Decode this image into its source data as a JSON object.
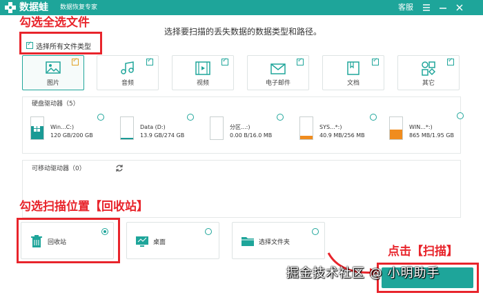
{
  "titlebar": {
    "app_name": "数据蛙",
    "app_subtitle": "数据恢复专家",
    "service_label": "客服",
    "menu_icon": "menu-icon",
    "min_icon": "minimize-icon",
    "close_icon": "close-icon"
  },
  "annotations": {
    "select_all_note": "勾选全选文件",
    "location_note": "勾选扫描位置【回收站】",
    "scan_note": "点击【扫描】"
  },
  "instruction": "选择要扫描的丢失数据的数据类型和路径。",
  "select_all": {
    "label": "选择所有文件类型",
    "checked": true
  },
  "file_types": [
    {
      "label": "图片",
      "icon": "image-icon",
      "checked": true,
      "selected": true
    },
    {
      "label": "音频",
      "icon": "music-icon",
      "checked": true,
      "selected": false
    },
    {
      "label": "视频",
      "icon": "video-icon",
      "checked": true,
      "selected": false
    },
    {
      "label": "电子邮件",
      "icon": "email-icon",
      "checked": true,
      "selected": false
    },
    {
      "label": "文档",
      "icon": "document-icon",
      "checked": true,
      "selected": false
    },
    {
      "label": "其它",
      "icon": "other-icon",
      "checked": true,
      "selected": false
    }
  ],
  "hard_drives": {
    "title": "硬盘驱动器（5）",
    "items": [
      {
        "name": "Win...C:)",
        "size": "120 GB/200 GB",
        "used": 0.6,
        "color": "#1a9a95",
        "windows": true
      },
      {
        "name": "Data (D:)",
        "size": "13.9 GB/274 GB",
        "used": 0.05,
        "color": "#1a9a95",
        "windows": false
      },
      {
        "name": "分区...:)",
        "size": "0.00  B/16.0 MB",
        "used": 0.0,
        "color": "#1a9a95",
        "windows": false
      },
      {
        "name": "SYS...*:)",
        "size": "40.9 MB/256 MB",
        "used": 0.16,
        "color": "#f08c1e",
        "windows": false
      },
      {
        "name": "WIN...*:)",
        "size": "865 MB/1.95 GB",
        "used": 0.44,
        "color": "#f08c1e",
        "windows": false
      }
    ]
  },
  "removable": {
    "title": "可移动驱动器（0）",
    "refresh_icon": "refresh-icon"
  },
  "locations": [
    {
      "label": "回收站",
      "icon": "trash-icon",
      "selected": true
    },
    {
      "label": "桌面",
      "icon": "desktop-icon",
      "selected": false
    },
    {
      "label": "选择文件夹",
      "icon": "folder-icon",
      "selected": false
    }
  ],
  "watermark": "掘金技术社区 @ 小明助手",
  "colors": {
    "accent": "#1ea59a",
    "annotation": "#e8242b",
    "warning": "#f08c1e"
  }
}
